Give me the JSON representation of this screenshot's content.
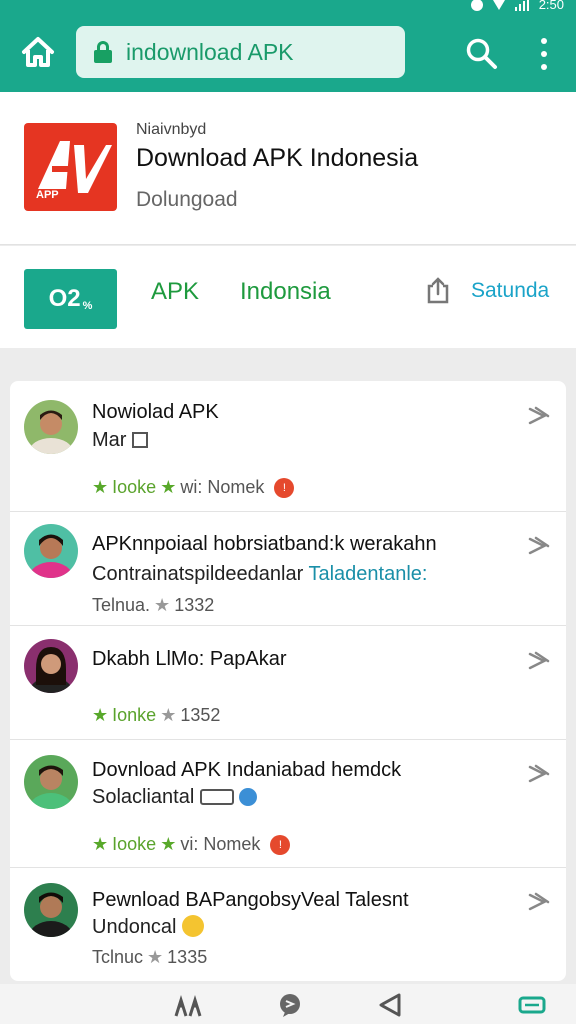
{
  "status": {
    "time": "2:50"
  },
  "browser": {
    "url": "indownload APK",
    "icons": {
      "home": "home-icon",
      "lock": "lock-icon",
      "search": "search-icon",
      "more": "more-vert-icon"
    }
  },
  "app": {
    "developer": "Niaivnbyd",
    "title": "Download APK Indonesia",
    "subtitle": "Dolungoad",
    "logo_text": "APP"
  },
  "actions": {
    "install_label": "O2",
    "install_small": "%",
    "tab_apk": "APK",
    "tab_indonesia": "Indonsia",
    "share_label": "Satunda"
  },
  "reviews": [
    {
      "title": "Nowiolad APK",
      "line2": "Mar",
      "meta_label": "Iooke",
      "meta_extra": "wi: Nomek",
      "badge": "!"
    },
    {
      "title": "APKnnpoiaal hobrsiatband:k werakahn",
      "line2": "Contrainatspildeedanlar",
      "line2_teal": "Taladentanle:",
      "meta_label": "Telnua.",
      "meta_count": "1332"
    },
    {
      "title": "Dkabh LlMo: PapAkar",
      "meta_label": "Ionke",
      "meta_count": "1352"
    },
    {
      "title": "Dovnload APK Indaniabad hemdck",
      "line2": "Solacliantal",
      "meta_label": "Iooke",
      "meta_extra": "vi: Nomek",
      "badge": "!"
    },
    {
      "title": "Pewnload BAPangobsyVeal Talesnt",
      "line2": "Undoncal",
      "meta_label": "Tclnuc",
      "meta_count": "1335"
    }
  ],
  "colors": {
    "primary": "#1aa88c",
    "logo": "#e53522",
    "green_text": "#1e9a3e",
    "link": "#1aa3c8",
    "star_green": "#58a82a"
  }
}
